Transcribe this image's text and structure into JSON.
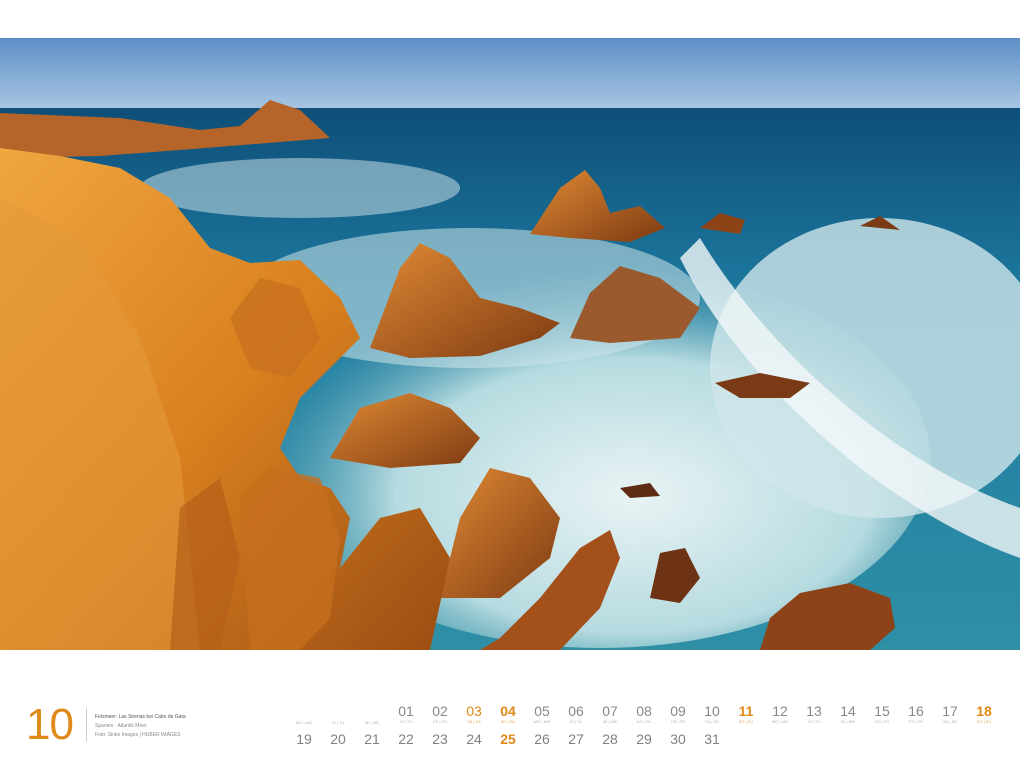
{
  "month": "10",
  "caption": {
    "line1": "Felsmeer: Las Sirenas bei Cabo de Gata",
    "line2": "Spanien · Atlantik Meer",
    "line3": "Foto: Sinke Images | HUBER IMAGES"
  },
  "row1": [
    {
      "num": "01",
      "wd": "DI | TU",
      "kind": "wk"
    },
    {
      "num": "02",
      "wd": "FR | FR",
      "kind": "wk"
    },
    {
      "num": "03",
      "wd": "SA | SA",
      "kind": "sat"
    },
    {
      "num": "04",
      "wd": "SO | SU",
      "kind": "sun"
    },
    {
      "num": "05",
      "wd": "MO | MO",
      "kind": "wk"
    },
    {
      "num": "06",
      "wd": "DI | TU",
      "kind": "wk"
    },
    {
      "num": "07",
      "wd": "MI | WE",
      "kind": "wk"
    },
    {
      "num": "08",
      "wd": "DO | TH",
      "kind": "wk"
    },
    {
      "num": "09",
      "wd": "FR | FR",
      "kind": "wk"
    },
    {
      "num": "10",
      "wd": "SA | SA",
      "kind": "wk"
    },
    {
      "num": "11",
      "wd": "SO | SU",
      "kind": "sun"
    },
    {
      "num": "12",
      "wd": "MO | MO",
      "kind": "wk"
    },
    {
      "num": "13",
      "wd": "DI | TU",
      "kind": "wk"
    },
    {
      "num": "14",
      "wd": "MI | WE",
      "kind": "wk"
    },
    {
      "num": "15",
      "wd": "DO | TH",
      "kind": "wk"
    },
    {
      "num": "16",
      "wd": "FR | FR",
      "kind": "wk"
    },
    {
      "num": "17",
      "wd": "SA | SA",
      "kind": "wk"
    },
    {
      "num": "18",
      "wd": "SO | SU",
      "kind": "sun"
    }
  ],
  "row1_lead_labels": [
    "MO | MO",
    "DI | TU",
    "MI | WE"
  ],
  "row2": [
    {
      "num": "19",
      "kind": "wk"
    },
    {
      "num": "20",
      "kind": "wk"
    },
    {
      "num": "21",
      "kind": "wk"
    },
    {
      "num": "22",
      "kind": "wk"
    },
    {
      "num": "23",
      "kind": "wk"
    },
    {
      "num": "24",
      "kind": "wk"
    },
    {
      "num": "25",
      "kind": "sun"
    },
    {
      "num": "26",
      "kind": "wk"
    },
    {
      "num": "27",
      "kind": "wk"
    },
    {
      "num": "28",
      "kind": "wk"
    },
    {
      "num": "29",
      "kind": "wk"
    },
    {
      "num": "30",
      "kind": "wk"
    },
    {
      "num": "31",
      "kind": "wk"
    }
  ],
  "colors": {
    "accent": "#e0891a",
    "sea": "#1f6d8c",
    "sky": "#6f9fd0",
    "rock": "#d47a1f"
  }
}
